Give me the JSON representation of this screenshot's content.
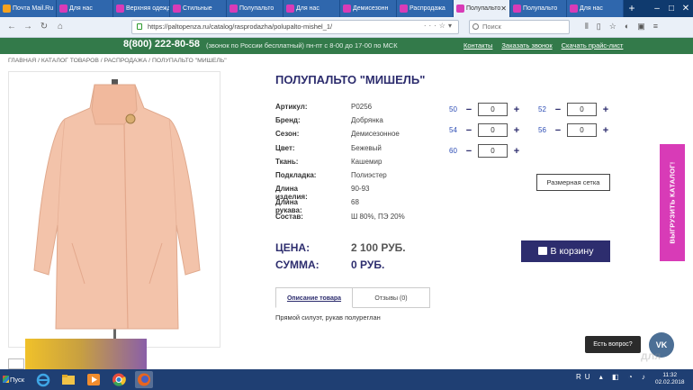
{
  "browser": {
    "tabs": [
      {
        "label": "Почта Mail.Ru",
        "color": "#f6a21e",
        "active": false
      },
      {
        "label": "Для нас",
        "color": "#d83bb7",
        "active": false
      },
      {
        "label": "Верхняя одежда",
        "color": "#d83bb7",
        "active": false
      },
      {
        "label": "Стильные",
        "color": "#d83bb7",
        "active": false
      },
      {
        "label": "Полупальто",
        "color": "#d83bb7",
        "active": false
      },
      {
        "label": "Для нас",
        "color": "#d83bb7",
        "active": false
      },
      {
        "label": "Демисезонн",
        "color": "#d83bb7",
        "active": false
      },
      {
        "label": "Распродажа",
        "color": "#d83bb7",
        "active": false
      },
      {
        "label": "Полупальто",
        "color": "#d83bb7",
        "active": true
      },
      {
        "label": "Полупальто",
        "color": "#d83bb7",
        "active": false
      },
      {
        "label": "Для нас",
        "color": "#d83bb7",
        "active": false
      }
    ],
    "url": "https://paltopenza.ru/catalog/rasprodazha/polupalto-mishel_1/",
    "search_placeholder": "Поиск"
  },
  "topbar": {
    "phone": "8(800) 222-80-58",
    "phone_note": "(звонок по России бесплатный)  пн-пт с 8-00 до 17-00 по МСК",
    "links": [
      "Контакты",
      "Заказать звонок",
      "Скачать прайс-лист"
    ]
  },
  "breadcrumb": "ГЛАВНАЯ / КАТАЛОГ ТОВАРОВ / РАСПРОДАЖА / ПОЛУПАЛЬТО \"МИШЕЛЬ\"",
  "product": {
    "title": "ПОЛУПАЛЬТО \"МИШЕЛЬ\"",
    "specs": [
      {
        "key": "Артикул:",
        "value": "Р0256"
      },
      {
        "key": "Бренд:",
        "value": "Добрянка"
      },
      {
        "key": "Сезон:",
        "value": "Демисезонное"
      },
      {
        "key": "Цвет:",
        "value": "Бежевый"
      },
      {
        "key": "Ткань:",
        "value": "Кашемир"
      },
      {
        "key": "Подкладка:",
        "value": "Полиэстер"
      },
      {
        "key": "Длина изделия:",
        "value": "90-93"
      },
      {
        "key": "Длина рукава:",
        "value": "68"
      },
      {
        "key": "Состав:",
        "value": "Ш 80%, ПЭ 20%"
      }
    ],
    "sizes": [
      {
        "size": "50",
        "qty": "0"
      },
      {
        "size": "52",
        "qty": "0"
      },
      {
        "size": "54",
        "qty": "0"
      },
      {
        "size": "56",
        "qty": "0"
      },
      {
        "size": "60",
        "qty": "0"
      }
    ],
    "size_chart_label": "Размерная сетка",
    "price_label": "ЦЕНА:",
    "price_value": "2 100 РУБ.",
    "sum_label": "СУММА:",
    "sum_value": "0 РУБ.",
    "cart_label": "В корзину",
    "tabs": [
      "Описание товара",
      "Отзывы (0)"
    ],
    "description": "Прямой силуэт, рукав полуреглан"
  },
  "side_catalog": "ВЫГРУЗИТЬ КАТАЛОГ!",
  "ask_question": "Есть вопрос?",
  "vk_label": "VK",
  "watermark": "для",
  "taskbar": {
    "start_label": "Пуск",
    "time": "11:32",
    "date": "02.02.2018",
    "lang": "RU"
  },
  "colors": {
    "brand_green": "#337a4a",
    "brand_navy": "#2d2d6e",
    "accent_pink": "#d83bb7",
    "coat": "#f3c3aa"
  }
}
